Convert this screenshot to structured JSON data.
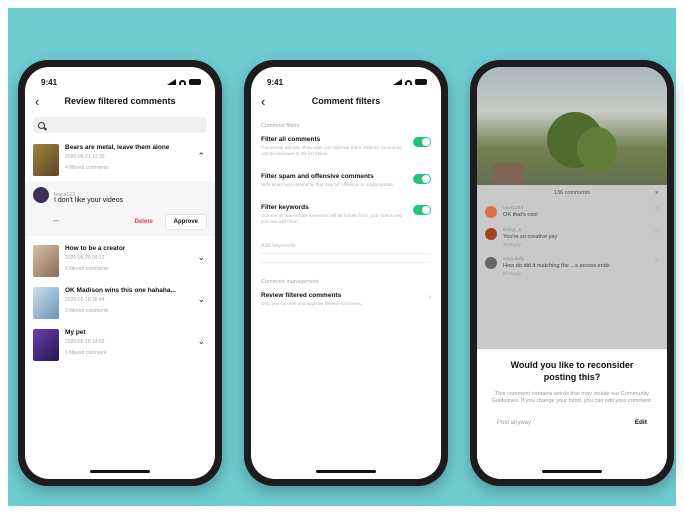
{
  "colors": {
    "background": "#6ecbd0",
    "toggle_on": "#25c47c",
    "delete": "#fe2c55"
  },
  "phone1": {
    "status_time": "9:41",
    "title": "Review filtered comments",
    "search_icon": "search-icon",
    "videos": [
      {
        "title": "Bears are metal, leave them alone",
        "sub": "2020-05-21 12:35",
        "count": "4 filtered comments",
        "expanded": true,
        "thumb_color": "#8a6d3c"
      },
      {
        "title": "How to be a creator",
        "sub": "2020-05-20 09:12",
        "count": "3 filtered comments",
        "expanded": false,
        "thumb_color": "#b89a84"
      },
      {
        "title": "OK Madison wins this one hahaha...",
        "sub": "2020-05-19 18:44",
        "count": "2 filtered comments",
        "expanded": false,
        "thumb_color": "#8cb5d9"
      },
      {
        "title": "My pet",
        "sub": "2020-05-18 14:02",
        "count": "1 filtered comment",
        "expanded": false,
        "thumb_color": "#3e2a70"
      }
    ],
    "comment": {
      "user": "bruce123",
      "text": "I don't like your videos",
      "dots": "•••",
      "delete": "Delete",
      "approve": "Approve"
    }
  },
  "phone2": {
    "status_time": "9:41",
    "title": "Comment filters",
    "section1": "Comment filters",
    "toggles": [
      {
        "title": "Filter all comments",
        "desc": "Comments will only show after you approve them. Filtered comments can be reviewed in the list below.",
        "on": true
      },
      {
        "title": "Filter spam and offensive comments",
        "desc": "Hide spam and comments that may be offensive or inappropriate.",
        "on": true
      },
      {
        "title": "Filter keywords",
        "desc": "Comments that include keywords will be hidden from your videos and you can add them.",
        "on": true
      }
    ],
    "keyword_placeholder": "Add keywords",
    "section2": "Comment management",
    "review": {
      "title": "Review filtered comments",
      "desc": "Only you can see and approve filtered comments."
    }
  },
  "phone3": {
    "panel_title": "136 comments",
    "panel_close": "×",
    "comments": [
      {
        "user": "user1234",
        "body": "OK that's cool",
        "meta": "2h  Reply",
        "color": "#d9704c"
      },
      {
        "user": "vickyy_s",
        "body": "You're so creative yay",
        "meta": "3h  Reply",
        "color": "#a4431c"
      },
      {
        "user": "xoxo.daily",
        "body": "How do did it matching the ...s across ends",
        "meta": "5h  Reply",
        "color": "#656565"
      },
      {
        "user": "lululu",
        "body": "Amazing",
        "meta": "6h  Reply",
        "color": "#3a2a4a"
      }
    ],
    "modal": {
      "title": "Would you like to reconsider posting this?",
      "body": "This comment contains words that may violate our Community Guidelines. If you change your mind, you can edit your comment.",
      "post_anyway": "Post anyway",
      "edit": "Edit"
    }
  }
}
